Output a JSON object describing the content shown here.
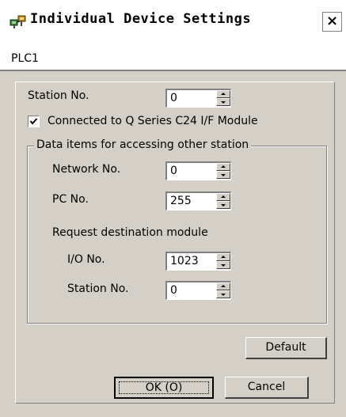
{
  "window": {
    "title": "Individual Device Settings",
    "close_label": "×"
  },
  "device": {
    "name": "PLC1"
  },
  "settings": {
    "station_no_label": "Station No.",
    "station_no_value": "0",
    "q_series_label": "Connected to Q Series C24 I/F Module",
    "q_series_checked": true
  },
  "group": {
    "legend": "Data items for accessing other station",
    "network_no_label": "Network No.",
    "network_no_value": "0",
    "pc_no_label": "PC No.",
    "pc_no_value": "255",
    "request_label": "Request destination module",
    "io_no_label": "I/O No.",
    "io_no_value": "1023",
    "station_no_label": "Station No.",
    "station_no_value": "0"
  },
  "buttons": {
    "default_label": "Default",
    "ok_label": "OK (O)",
    "cancel_label": "Cancel"
  },
  "icons": {
    "title": "network-devices-icon",
    "checkbox": "checkmark-icon"
  }
}
